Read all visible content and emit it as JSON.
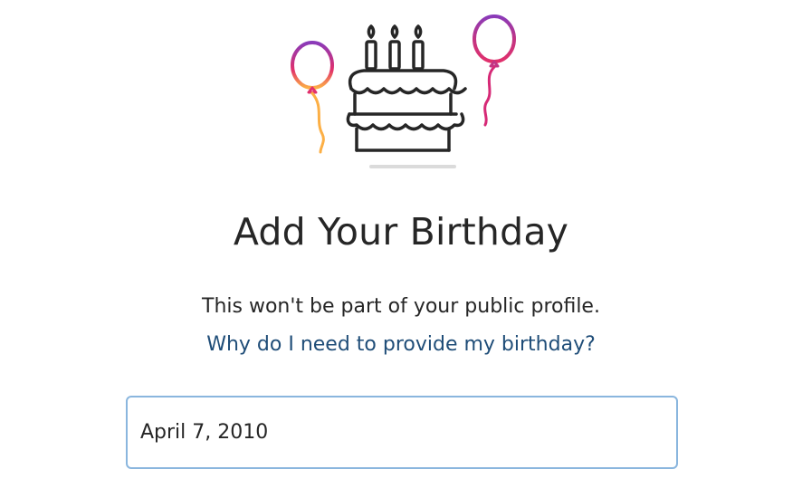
{
  "screen": {
    "title": "Add Your Birthday",
    "subtitle": "This won't be part of your public profile.",
    "help_link": "Why do I need to provide my birthday?",
    "birthday_field": {
      "value": "April 7, 2010"
    }
  },
  "illustration": {
    "icon": "birthday-cake-with-balloons",
    "colors": {
      "line": "#262626",
      "balloon_left_top": "#8a3ab9",
      "balloon_left_bottom": "#f77737",
      "balloon_right_top": "#c13584",
      "balloon_right_bottom": "#e1306c",
      "shadow": "#dbdbdb"
    }
  },
  "colors": {
    "text": "#262626",
    "link": "#1f4d78",
    "field_border": "#8ab6de",
    "background": "#ffffff"
  }
}
